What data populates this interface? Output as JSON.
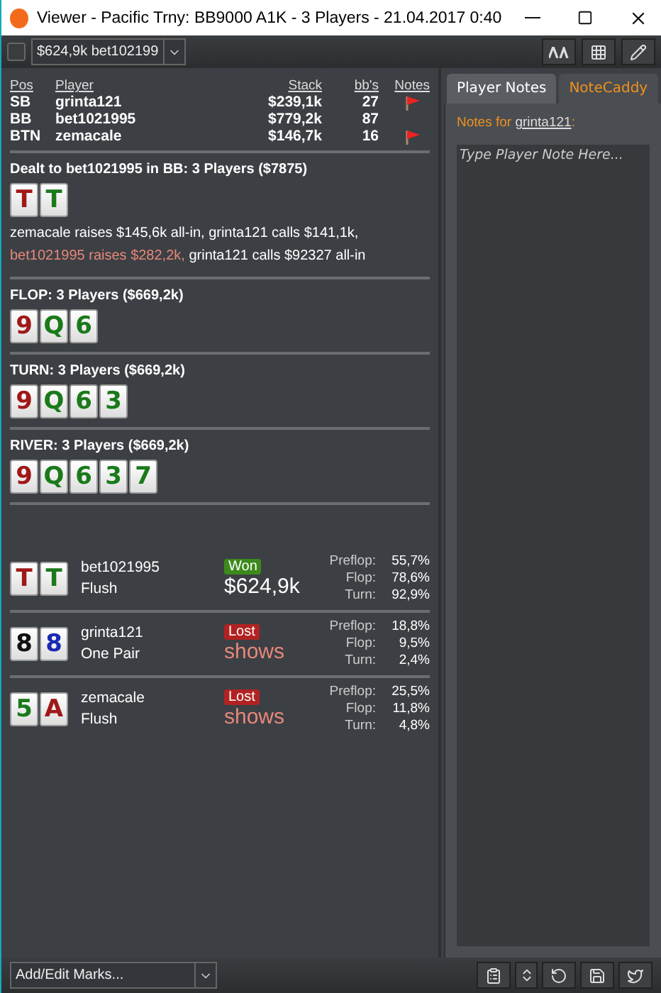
{
  "window": {
    "title": "Viewer - Pacific Trny: BB9000 A1K - 3 Players - 21.04.2017 0:40"
  },
  "toolbar": {
    "checked": false,
    "hand_select": "$624,9k bet102199"
  },
  "players": {
    "columns": [
      "Pos",
      "Player",
      "Stack",
      "bb's",
      "Notes"
    ],
    "rows": [
      {
        "pos": "SB",
        "name": "grinta121",
        "stack": "$239,1k",
        "bbs": "27",
        "has_note": true
      },
      {
        "pos": "BB",
        "name": "bet1021995",
        "stack": "$779,2k",
        "bbs": "87",
        "has_note": false
      },
      {
        "pos": "BTN",
        "name": "zemacale",
        "stack": "$146,7k",
        "bbs": "16",
        "has_note": true
      }
    ]
  },
  "streets": [
    {
      "title": "Dealt to bet1021995 in BB: 3 Players ($7875)",
      "cards": [
        {
          "rank": "T",
          "color": "#a01818"
        },
        {
          "rank": "T",
          "color": "#1a7a1a"
        }
      ],
      "actions": [
        {
          "text": "zemacale raises $145,6k all-in, grinta121 calls $141,1k,",
          "hero": false
        },
        {
          "text": "bet1021995 raises $282,2k,",
          "hero": true
        },
        {
          "text": "grinta121 calls $92327 all-in",
          "hero": false
        }
      ]
    },
    {
      "title": "FLOP: 3 Players ($669,2k)",
      "cards": [
        {
          "rank": "9",
          "color": "#a01818"
        },
        {
          "rank": "Q",
          "color": "#1a7a1a"
        },
        {
          "rank": "6",
          "color": "#1a7a1a"
        }
      ]
    },
    {
      "title": "TURN: 3 Players ($669,2k)",
      "cards": [
        {
          "rank": "9",
          "color": "#a01818"
        },
        {
          "rank": "Q",
          "color": "#1a7a1a"
        },
        {
          "rank": "6",
          "color": "#1a7a1a"
        },
        {
          "rank": "3",
          "color": "#1a7a1a"
        }
      ]
    },
    {
      "title": "RIVER: 3 Players ($669,2k)",
      "cards": [
        {
          "rank": "9",
          "color": "#a01818"
        },
        {
          "rank": "Q",
          "color": "#1a7a1a"
        },
        {
          "rank": "6",
          "color": "#1a7a1a"
        },
        {
          "rank": "3",
          "color": "#1a7a1a"
        },
        {
          "rank": "7",
          "color": "#1a7a1a"
        }
      ]
    }
  ],
  "results": [
    {
      "cards": [
        {
          "rank": "T",
          "color": "#a01818"
        },
        {
          "rank": "T",
          "color": "#1a7a1a"
        }
      ],
      "name": "bet1021995",
      "hand": "Flush",
      "won": true,
      "badge": "Won",
      "amount": "$624,9k",
      "equity": [
        {
          "label": "Preflop:",
          "value": "55,7%"
        },
        {
          "label": "Flop:",
          "value": "78,6%"
        },
        {
          "label": "Turn:",
          "value": "92,9%"
        }
      ]
    },
    {
      "cards": [
        {
          "rank": "8",
          "color": "#111111"
        },
        {
          "rank": "8",
          "color": "#1a2ab0"
        }
      ],
      "name": "grinta121",
      "hand": "One Pair",
      "won": false,
      "badge": "Lost",
      "amount": "shows",
      "equity": [
        {
          "label": "Preflop:",
          "value": "18,8%"
        },
        {
          "label": "Flop:",
          "value": "9,5%"
        },
        {
          "label": "Turn:",
          "value": "2,4%"
        }
      ]
    },
    {
      "cards": [
        {
          "rank": "5",
          "color": "#1a7a1a"
        },
        {
          "rank": "A",
          "color": "#a01818"
        }
      ],
      "name": "zemacale",
      "hand": "Flush",
      "won": false,
      "badge": "Lost",
      "amount": "shows",
      "equity": [
        {
          "label": "Preflop:",
          "value": "25,5%"
        },
        {
          "label": "Flop:",
          "value": "11,8%"
        },
        {
          "label": "Turn:",
          "value": "4,8%"
        }
      ]
    }
  ],
  "notes_panel": {
    "tabs": [
      {
        "label": "Player Notes",
        "selected": true
      },
      {
        "label": "NoteCaddy",
        "selected": false
      }
    ],
    "notes_for": "Notes for",
    "player": "grinta121",
    "colon": ":",
    "placeholder": "Type Player Note Here..."
  },
  "footer": {
    "marks_select": "Add/Edit Marks..."
  }
}
